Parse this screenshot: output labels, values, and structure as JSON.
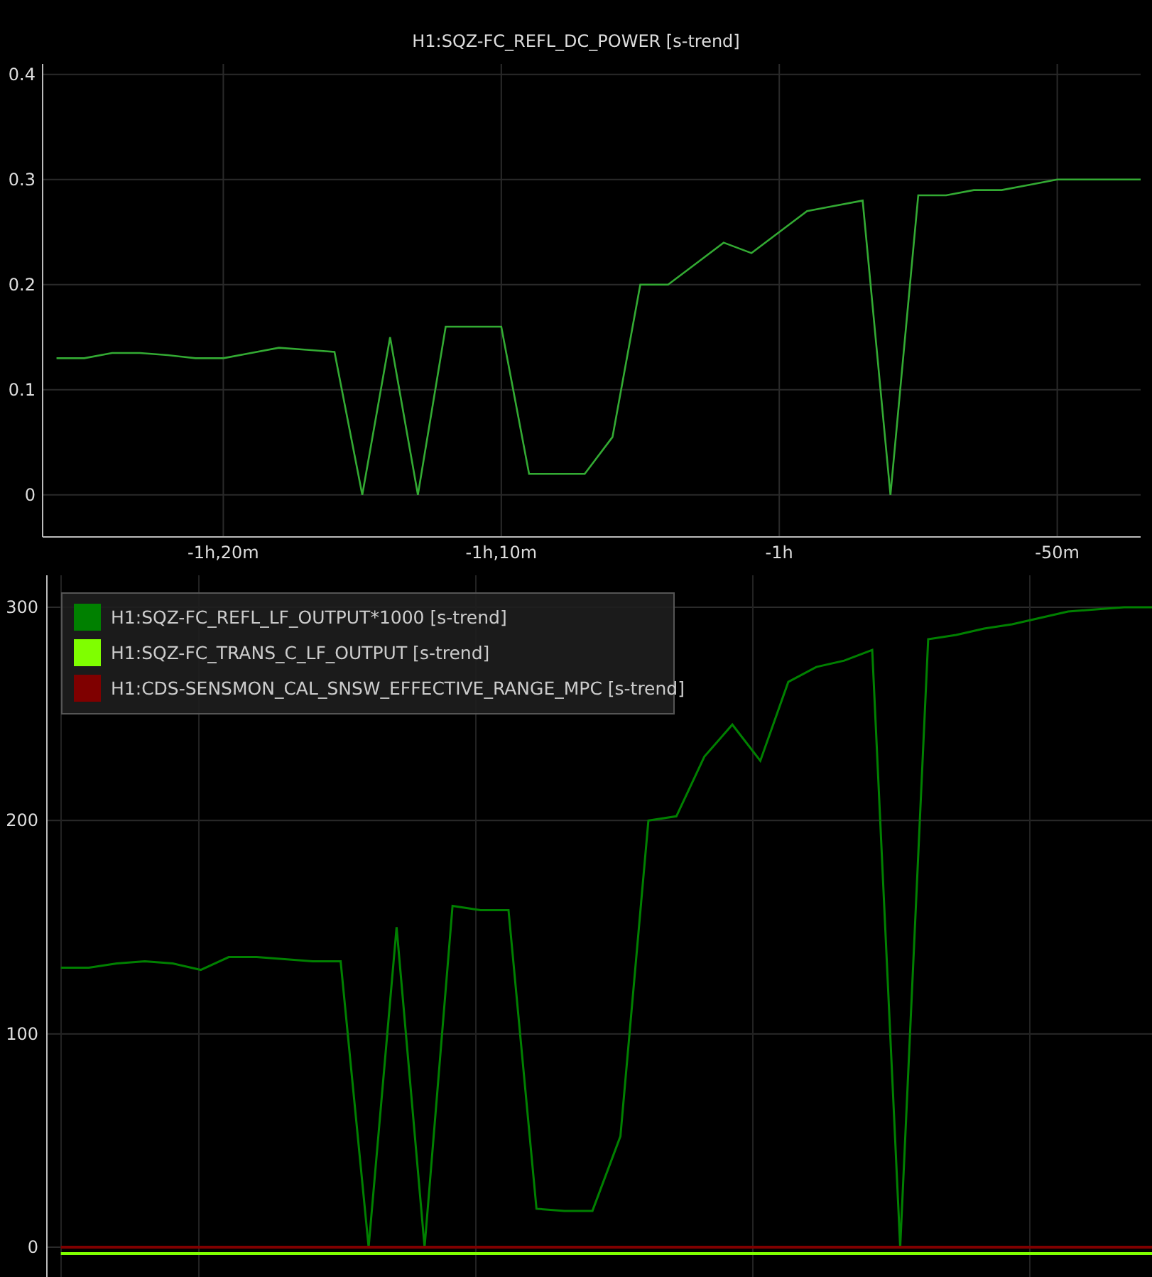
{
  "top_plot": {
    "chart_data": {
      "type": "line",
      "title": "H1:SQZ-FC_REFL_DC_POWER [s-trend]",
      "categories": [
        null,
        null,
        null,
        null,
        null,
        null,
        "-1h,20m",
        null,
        null,
        null,
        null,
        null,
        null,
        null,
        null,
        null,
        "-1h,10m",
        null,
        null,
        null,
        null,
        null,
        null,
        null,
        null,
        null,
        "-1h",
        null,
        null,
        null,
        null,
        null,
        null,
        null,
        null,
        null,
        "-50m",
        null,
        null,
        null
      ],
      "values": [
        0.13,
        0.13,
        0.135,
        0.135,
        0.133,
        0.13,
        0.13,
        0.135,
        0.14,
        0.138,
        0.136,
        0.0,
        0.15,
        0.0,
        0.16,
        0.16,
        0.16,
        0.02,
        0.02,
        0.02,
        0.055,
        0.2,
        0.2,
        0.22,
        0.24,
        0.23,
        0.25,
        0.27,
        0.275,
        0.28,
        0.0,
        0.285,
        0.285,
        0.29,
        0.29,
        0.295,
        0.3,
        0.3,
        0.3,
        0.3
      ],
      "color": "#33aa33",
      "grid": true,
      "ylim": [
        -0.04,
        0.41
      ],
      "yticks": [
        {
          "value": 0,
          "label": "0"
        },
        {
          "value": 0.1,
          "label": "0.1"
        },
        {
          "value": 0.2,
          "label": "0.2"
        },
        {
          "value": 0.3,
          "label": "0.3"
        },
        {
          "value": 0.4,
          "label": "0.4"
        }
      ]
    }
  },
  "bottom_plot": {
    "chart_data": {
      "type": "line",
      "categories": [
        null,
        null,
        null,
        null,
        null,
        null,
        null,
        null,
        null,
        null,
        null,
        null,
        null,
        null,
        null,
        null,
        null,
        null,
        null,
        null,
        null,
        null,
        null,
        null,
        null,
        null,
        null,
        null,
        null,
        null,
        null,
        null,
        null,
        null,
        null,
        null,
        null,
        null,
        null,
        null
      ],
      "series": [
        {
          "name": "H1:SQZ-FC_REFL_LF_OUTPUT*1000 [s-trend]",
          "color": "#008000",
          "values": [
            131,
            131,
            133,
            134,
            133,
            130,
            136,
            136,
            135,
            134,
            134,
            0,
            150,
            0,
            160,
            158,
            158,
            18,
            17,
            17,
            52,
            200,
            202,
            230,
            245,
            228,
            265,
            272,
            275,
            280,
            0,
            285,
            287,
            290,
            292,
            295,
            298,
            299,
            300,
            300
          ]
        },
        {
          "name": "H1:SQZ-FC_TRANS_C_LF_OUTPUT [s-trend]",
          "color": "#7fff00",
          "values": [
            -3,
            -3,
            -3,
            -3,
            -3,
            -3,
            -3,
            -3,
            -3,
            -3,
            -3,
            -3,
            -3,
            -3,
            -3,
            -3,
            -3,
            -3,
            -3,
            -3,
            -3,
            -3,
            -3,
            -3,
            -3,
            -3,
            -3,
            -3,
            -3,
            -3,
            -3,
            -3,
            -3,
            -3,
            -3,
            -3,
            -3,
            -3,
            -3,
            -3
          ]
        },
        {
          "name": "H1:CDS-SENSMON_CAL_SNSW_EFFECTIVE_RANGE_MPC [s-trend]",
          "color": "#7f0000",
          "values": [
            0,
            0,
            0,
            0,
            0,
            0,
            0,
            0,
            0,
            0,
            0,
            0,
            0,
            0,
            0,
            0,
            0,
            0,
            0,
            0,
            0,
            0,
            0,
            0,
            0,
            0,
            0,
            0,
            0,
            0,
            0,
            0,
            0,
            0,
            0,
            0,
            0,
            0,
            0,
            0
          ]
        }
      ],
      "grid": true,
      "ylim": [
        -14,
        315
      ],
      "yticks": [
        {
          "value": 0,
          "label": "0"
        },
        {
          "value": 100,
          "label": "100"
        },
        {
          "value": 200,
          "label": "200"
        },
        {
          "value": 300,
          "label": "300"
        }
      ]
    }
  }
}
